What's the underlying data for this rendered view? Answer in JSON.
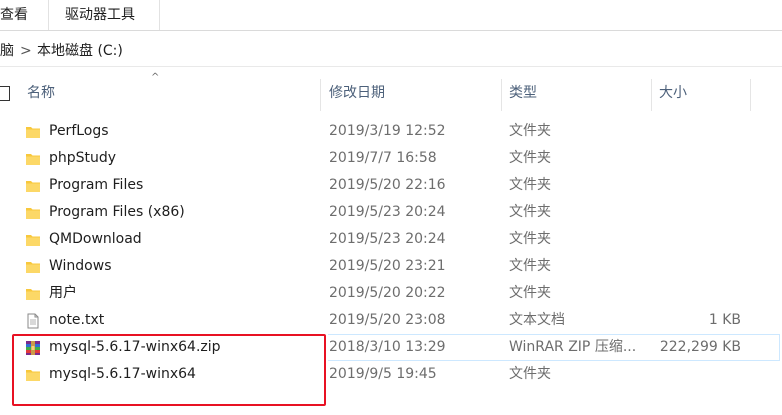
{
  "ribbon": {
    "tabs": [
      {
        "label": "查看"
      },
      {
        "label": "驱动器工具"
      }
    ]
  },
  "address": {
    "prev_segment": "脑",
    "separator": ">",
    "current": "本地磁盘 (C:)"
  },
  "header": {
    "name": "名称",
    "date": "修改日期",
    "type": "类型",
    "size": "大小"
  },
  "files": [
    {
      "name": "PerfLogs",
      "date": "2019/3/19 12:52",
      "type": "文件夹",
      "size": "",
      "icon": "folder-icon"
    },
    {
      "name": "phpStudy",
      "date": "2019/7/7 16:58",
      "type": "文件夹",
      "size": "",
      "icon": "folder-icon"
    },
    {
      "name": "Program Files",
      "date": "2019/5/20 22:16",
      "type": "文件夹",
      "size": "",
      "icon": "folder-icon"
    },
    {
      "name": "Program Files (x86)",
      "date": "2019/5/23 20:24",
      "type": "文件夹",
      "size": "",
      "icon": "folder-icon"
    },
    {
      "name": "QMDownload",
      "date": "2019/5/23 20:24",
      "type": "文件夹",
      "size": "",
      "icon": "folder-icon"
    },
    {
      "name": "Windows",
      "date": "2019/5/20 23:21",
      "type": "文件夹",
      "size": "",
      "icon": "folder-icon"
    },
    {
      "name": "用户",
      "date": "2019/5/20 20:22",
      "type": "文件夹",
      "size": "",
      "icon": "folder-icon"
    },
    {
      "name": "note.txt",
      "date": "2019/5/20 23:08",
      "type": "文本文档",
      "size": "1 KB",
      "icon": "text-file-icon"
    },
    {
      "name": "mysql-5.6.17-winx64.zip",
      "date": "2018/3/10 13:29",
      "type": "WinRAR ZIP 压缩...",
      "size": "222,299 KB",
      "icon": "winrar-archive-icon"
    },
    {
      "name": "mysql-5.6.17-winx64",
      "date": "2019/9/5 19:45",
      "type": "文件夹",
      "size": "",
      "icon": "folder-icon"
    }
  ],
  "colors": {
    "folder": "#f8c83c",
    "highlight_box": "#e81123",
    "header_text": "#4c607a"
  }
}
